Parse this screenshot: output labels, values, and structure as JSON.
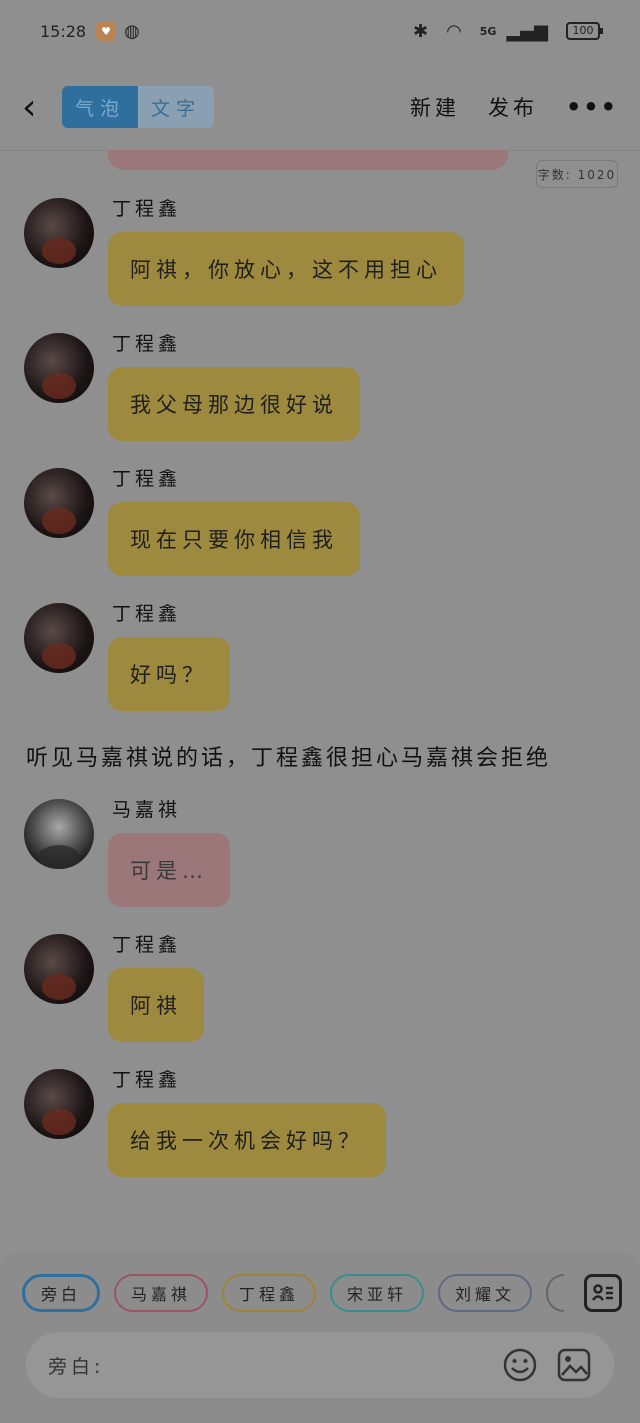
{
  "status_bar": {
    "time": "15:28",
    "network": "5G",
    "battery": "100"
  },
  "toolbar": {
    "tabs": [
      {
        "label": "气泡",
        "active": true
      },
      {
        "label": "文字",
        "active": false
      }
    ],
    "new_label": "新建",
    "publish_label": "发布",
    "more_label": "•••"
  },
  "word_count": "字数: 1020",
  "messages": [
    {
      "sender": "丁程鑫",
      "text": "阿祺，你放心，这不用担心",
      "color": "yellow"
    },
    {
      "sender": "丁程鑫",
      "text": "我父母那边很好说",
      "color": "yellow"
    },
    {
      "sender": "丁程鑫",
      "text": "现在只要你相信我",
      "color": "yellow"
    },
    {
      "sender": "丁程鑫",
      "text": "好吗？",
      "color": "yellow"
    },
    {
      "sender": "马嘉祺",
      "text": "可是…",
      "color": "pink"
    },
    {
      "sender": "丁程鑫",
      "text": "阿祺",
      "color": "yellow"
    },
    {
      "sender": "丁程鑫",
      "text": "给我一次机会好吗？",
      "color": "yellow"
    }
  ],
  "narration": "听见马嘉祺说的话，丁程鑫很担心马嘉祺会拒绝",
  "role_chips": [
    {
      "label": "旁白",
      "color": "#2e6f9e"
    },
    {
      "label": "马嘉祺",
      "color": "#9b5460"
    },
    {
      "label": "丁程鑫",
      "color": "#9e8434"
    },
    {
      "label": "宋亚轩",
      "color": "#3b8c91"
    },
    {
      "label": "刘耀文",
      "color": "#5e6a80"
    }
  ],
  "input": {
    "label": "旁白:",
    "value": ""
  }
}
